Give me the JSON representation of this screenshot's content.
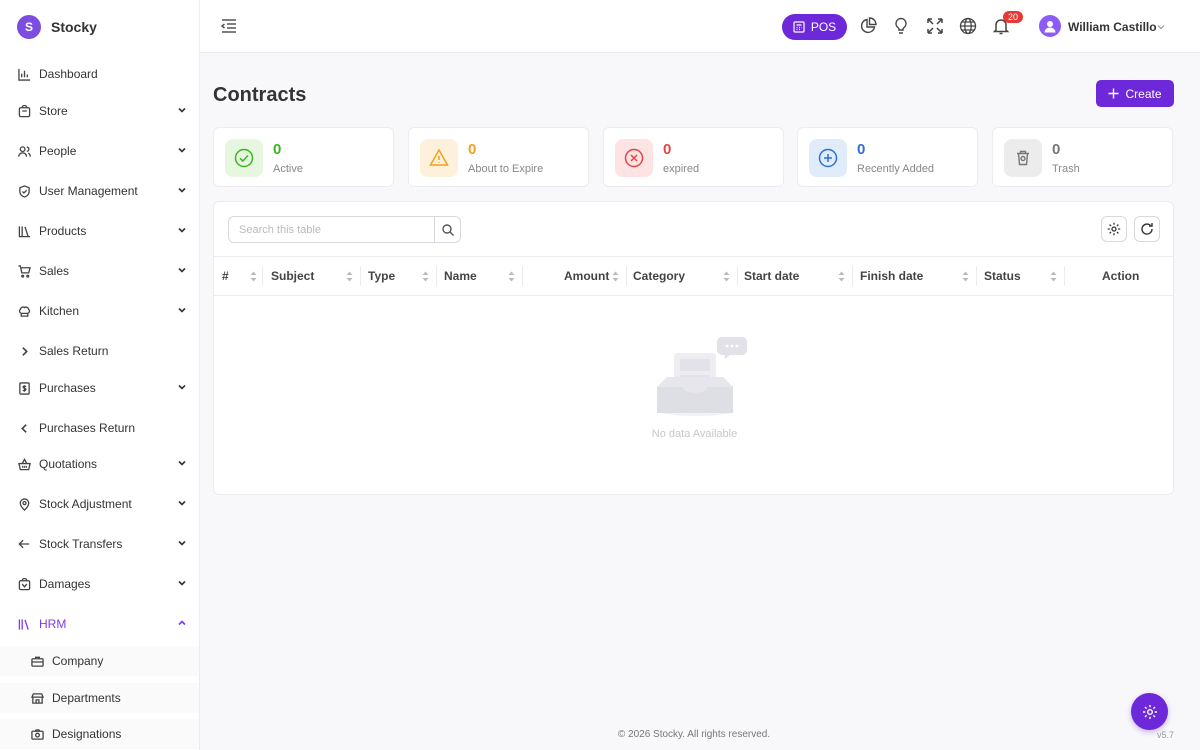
{
  "brand": {
    "name": "Stocky",
    "logo_letter": "S"
  },
  "sidebar": {
    "items": [
      {
        "label": "Dashboard",
        "icon": "bar-chart-icon"
      },
      {
        "label": "Store",
        "icon": "store-icon"
      },
      {
        "label": "People",
        "icon": "people-icon"
      },
      {
        "label": "User Management",
        "icon": "shield-icon"
      },
      {
        "label": "Products",
        "icon": "books-icon"
      },
      {
        "label": "Sales",
        "icon": "cart-icon"
      },
      {
        "label": "Kitchen",
        "icon": "chef-hat-icon"
      },
      {
        "label": "Sales Return",
        "icon": "chevron-right-icon"
      },
      {
        "label": "Purchases",
        "icon": "receipt-icon"
      },
      {
        "label": "Purchases Return",
        "icon": "chevron-left-icon"
      },
      {
        "label": "Quotations",
        "icon": "basket-icon"
      },
      {
        "label": "Stock Adjustment",
        "icon": "map-pin-icon"
      },
      {
        "label": "Stock Transfers",
        "icon": "arrow-left-icon"
      },
      {
        "label": "Damages",
        "icon": "damages-icon"
      },
      {
        "label": "HRM",
        "icon": "library-icon"
      }
    ],
    "sub_items": [
      {
        "label": "Company",
        "icon": "briefcase-icon"
      },
      {
        "label": "Departments",
        "icon": "building-icon"
      },
      {
        "label": "Designations",
        "icon": "camera-icon"
      }
    ]
  },
  "header": {
    "pos_label": "POS",
    "notification_count": "20",
    "user_name": "William Castillo"
  },
  "main": {
    "title": "Contracts",
    "create_label": "Create",
    "stats": [
      {
        "value": "0",
        "label": "Active",
        "color": "#3cb521",
        "bg": "#e6f6df"
      },
      {
        "value": "0",
        "label": "About to Expire",
        "color": "#f0a020",
        "bg": "#fdf1dc"
      },
      {
        "value": "0",
        "label": "expired",
        "color": "#e54545",
        "bg": "#fde3e3"
      },
      {
        "value": "0",
        "label": "Recently Added",
        "color": "#2f6fd8",
        "bg": "#e1ecfb"
      },
      {
        "value": "0",
        "label": "Trash",
        "color": "#777777",
        "bg": "#ececec"
      }
    ],
    "search": {
      "placeholder": "Search this table"
    },
    "columns": [
      "#",
      "Subject",
      "Type",
      "Name",
      "Amount",
      "Category",
      "Start date",
      "Finish date",
      "Status",
      "Action"
    ],
    "empty_text": "No data Available"
  },
  "footer": {
    "copyright": "© 2026 Stocky. All rights reserved.",
    "version": "v5.7"
  },
  "colors": {
    "accent": "#6d28d9",
    "active_nav": "#7c3aed"
  }
}
